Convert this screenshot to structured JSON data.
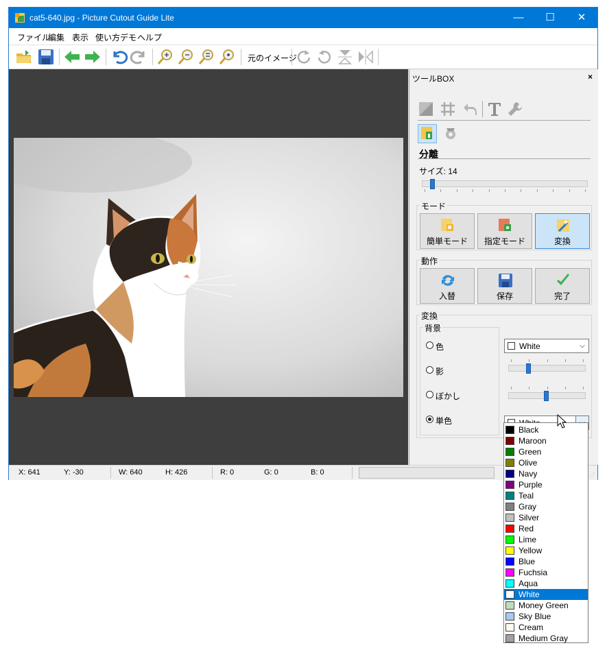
{
  "window": {
    "title": "cat5-640.jpg - Picture Cutout Guide Lite",
    "minimize_glyph": "—",
    "maximize_glyph": "☐",
    "close_glyph": "✕"
  },
  "menu": [
    "ファイル",
    "編集",
    "表示",
    "使い方デモ",
    "ヘルプ"
  ],
  "toolbar": {
    "original_image_label": "元のイメージ",
    "icons": [
      "open-folder-icon",
      "save-disk-icon",
      "back-arrow-icon",
      "forward-arrow-icon",
      "undo-icon",
      "redo-icon",
      "zoom-in-icon",
      "zoom-out-icon",
      "zoom-fit-icon",
      "zoom-actual-icon",
      "rotate-right-icon",
      "rotate-left-icon",
      "flip-vertical-icon",
      "flip-horizontal-icon"
    ]
  },
  "toolbox": {
    "title": "ツールBOX",
    "close_glyph": "×",
    "section_title": "分離",
    "size_label": "サイズ: 14",
    "size_value": 14,
    "mode": {
      "label": "モード",
      "buttons": [
        "簡単モード",
        "指定モード",
        "変換"
      ],
      "active_index": 2
    },
    "action": {
      "label": "動作",
      "buttons": [
        "入替",
        "保存",
        "完了"
      ]
    },
    "convert": {
      "label": "変換",
      "background_label": "背景",
      "radios": [
        "色",
        "影",
        "ぼかし",
        "単色"
      ],
      "selected_radio": 3,
      "color_combo": {
        "value": "White",
        "swatch": "#ffffff",
        "arrow": "⌵"
      },
      "shadow_slider_fraction": 0.26,
      "blur_slider_fraction": 0.5,
      "mono_combo": {
        "value": "White",
        "swatch": "#ffffff",
        "arrow": "⌵"
      }
    }
  },
  "dropdown": {
    "selected": "White",
    "options": [
      {
        "name": "Black",
        "color": "#000000"
      },
      {
        "name": "Maroon",
        "color": "#800000"
      },
      {
        "name": "Green",
        "color": "#008000"
      },
      {
        "name": "Olive",
        "color": "#808000"
      },
      {
        "name": "Navy",
        "color": "#000080"
      },
      {
        "name": "Purple",
        "color": "#800080"
      },
      {
        "name": "Teal",
        "color": "#008080"
      },
      {
        "name": "Gray",
        "color": "#808080"
      },
      {
        "name": "Silver",
        "color": "#c0c0c0"
      },
      {
        "name": "Red",
        "color": "#ff0000"
      },
      {
        "name": "Lime",
        "color": "#00ff00"
      },
      {
        "name": "Yellow",
        "color": "#ffff00"
      },
      {
        "name": "Blue",
        "color": "#0000ff"
      },
      {
        "name": "Fuchsia",
        "color": "#ff00ff"
      },
      {
        "name": "Aqua",
        "color": "#00ffff"
      },
      {
        "name": "White",
        "color": "#ffffff"
      },
      {
        "name": "Money Green",
        "color": "#c0dcc0"
      },
      {
        "name": "Sky Blue",
        "color": "#a6caf0"
      },
      {
        "name": "Cream",
        "color": "#fffbf0"
      },
      {
        "name": "Medium Gray",
        "color": "#a0a0a4"
      }
    ]
  },
  "status": {
    "x": "X: 641",
    "y": "Y: -30",
    "w": "W: 640",
    "h": "H: 426",
    "r": "R: 0",
    "g": "G: 0",
    "b": "B: 0"
  },
  "colors": {
    "titlebar": "#0078d7",
    "canvas": "#3e3e3e",
    "selection": "#0078d7",
    "slider_thumb": "#2a77d4"
  }
}
